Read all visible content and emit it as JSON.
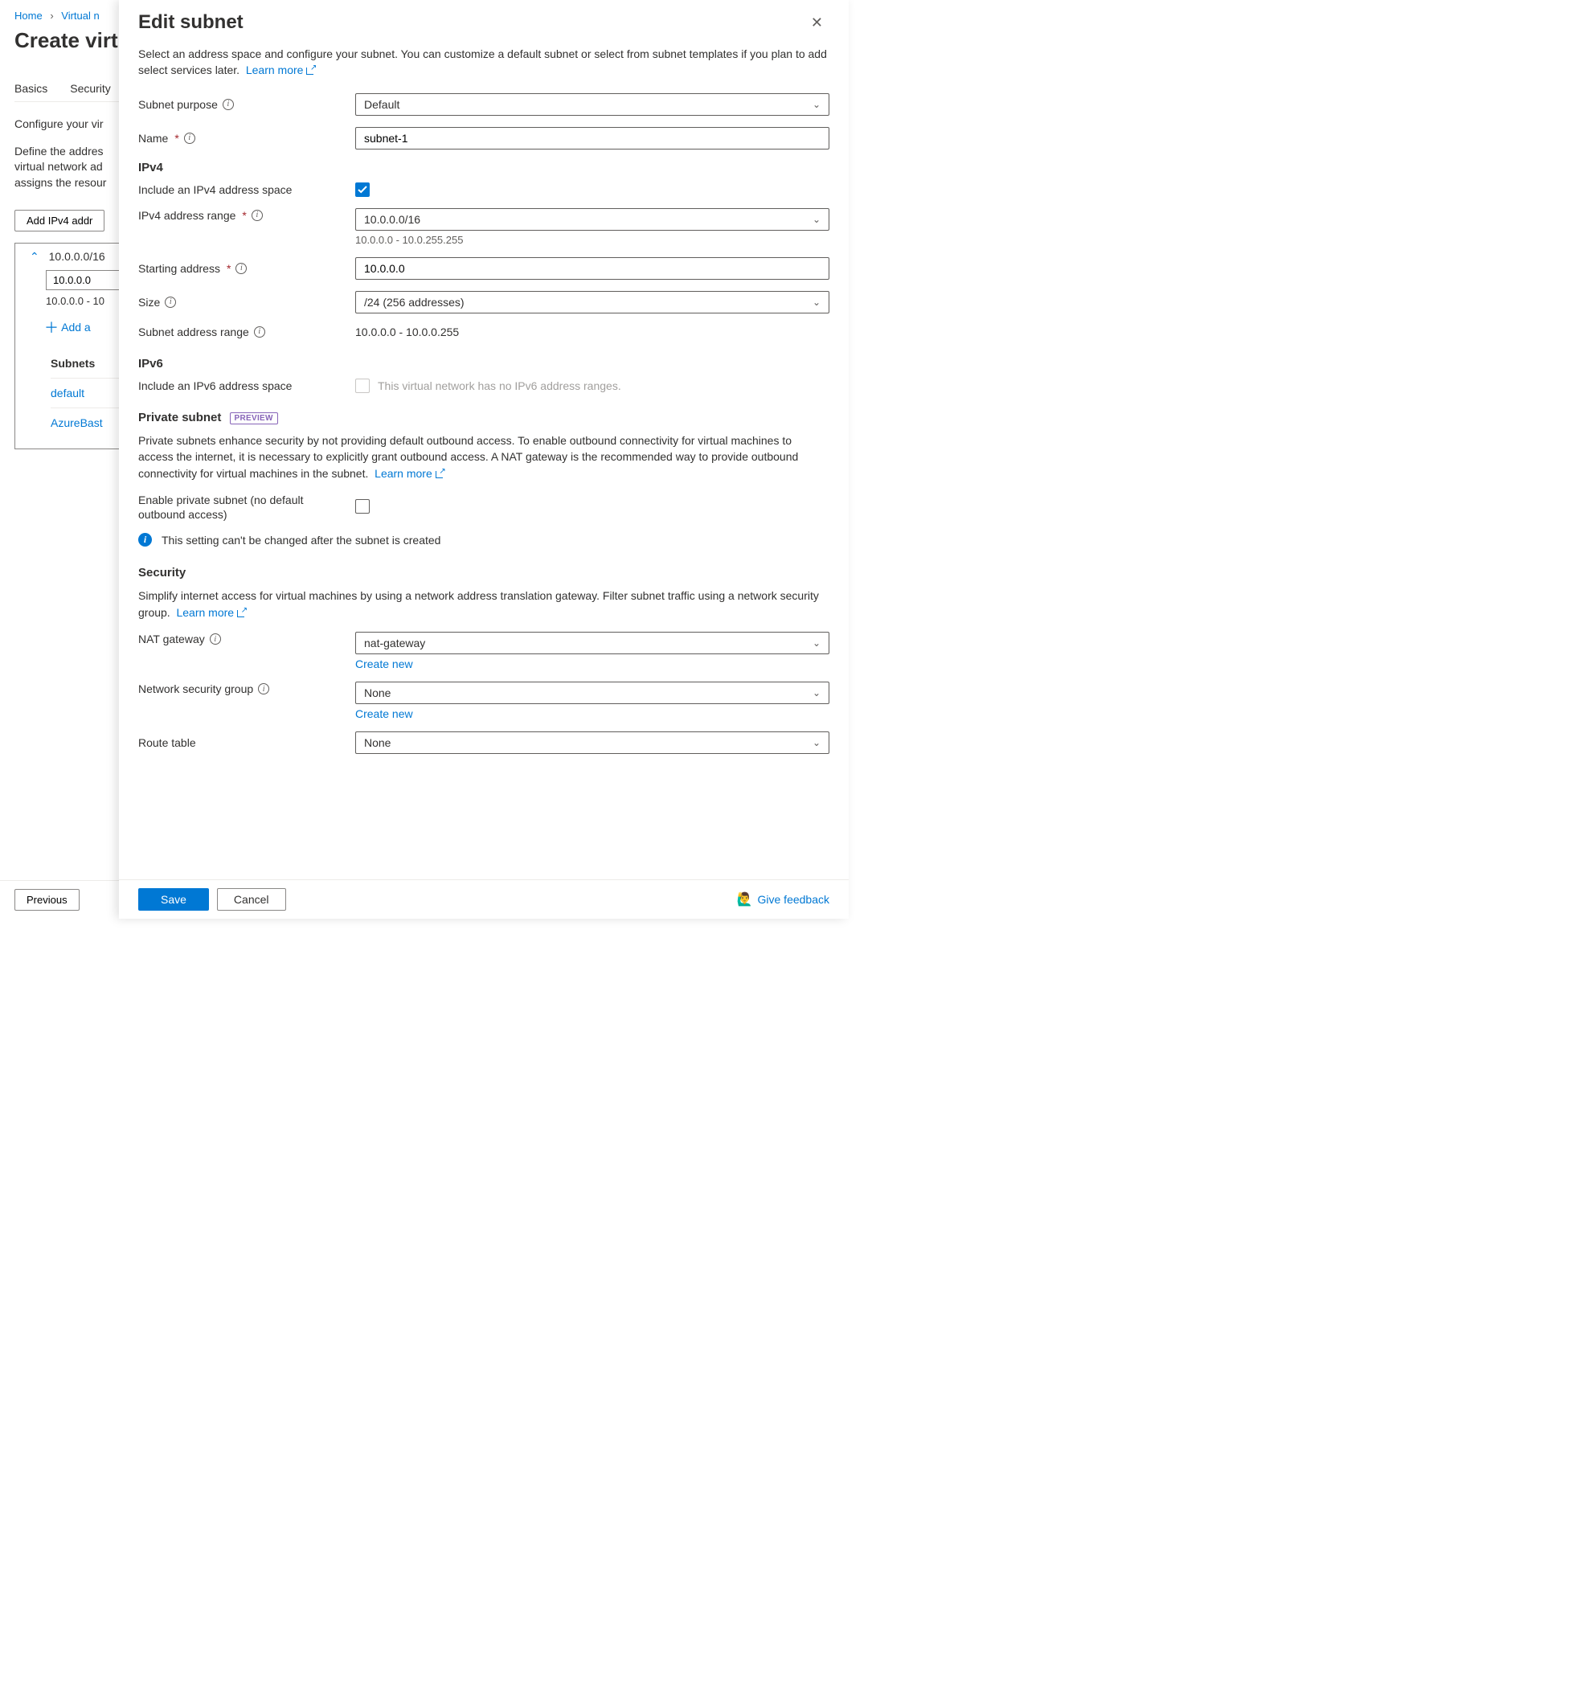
{
  "underlay": {
    "breadcrumb": {
      "home": "Home",
      "vn": "Virtual n"
    },
    "title": "Create virt",
    "tabs": {
      "basics": "Basics",
      "security": "Security"
    },
    "desc1": "Configure your vir",
    "desc2": "Define the addres",
    "desc3": "virtual network ad",
    "desc4": "assigns the resour",
    "add_button": "Add IPv4 addr",
    "cidr_line": "10.0.0.0/16",
    "addr_input": "10.0.0.0",
    "range_line": "10.0.0.0 - 10",
    "add_subnet": "Add a",
    "subnets_header": "Subnets",
    "subnet_default": "default",
    "subnet_bastion": "AzureBast",
    "previous": "Previous"
  },
  "panel": {
    "title": "Edit subnet",
    "intro": "Select an address space and configure your subnet. You can customize a default subnet or select from subnet templates if you plan to add select services later.",
    "learn_more": "Learn more",
    "purpose_label": "Subnet purpose",
    "purpose_value": "Default",
    "name_label": "Name",
    "name_value": "subnet-1",
    "ipv4_header": "IPv4",
    "include_ipv4_label": "Include an IPv4 address space",
    "ipv4_range_label": "IPv4 address range",
    "ipv4_range_value": "10.0.0.0/16",
    "ipv4_range_hint": "10.0.0.0 - 10.0.255.255",
    "starting_label": "Starting address",
    "starting_value": "10.0.0.0",
    "size_label": "Size",
    "size_value": "/24 (256 addresses)",
    "subnet_range_label": "Subnet address range",
    "subnet_range_value": "10.0.0.0 - 10.0.0.255",
    "ipv6_header": "IPv6",
    "include_ipv6_label": "Include an IPv6 address space",
    "ipv6_disabled_msg": "This virtual network has no IPv6 address ranges.",
    "private_header": "Private subnet",
    "preview_badge": "PREVIEW",
    "private_desc": "Private subnets enhance security by not providing default outbound access. To enable outbound connectivity for virtual machines to access the internet, it is necessary to explicitly grant outbound access. A NAT gateway is the recommended way to provide outbound connectivity for virtual machines in the subnet.",
    "enable_private_label": "Enable private subnet (no default outbound access)",
    "private_warning": "This setting can't be changed after the subnet is created",
    "security_header": "Security",
    "security_desc": "Simplify internet access for virtual machines by using a network address translation gateway. Filter subnet traffic using a network security group.",
    "nat_label": "NAT gateway",
    "nat_value": "nat-gateway",
    "nsg_label": "Network security group",
    "nsg_value": "None",
    "route_label": "Route table",
    "route_value": "None",
    "create_new": "Create new",
    "save": "Save",
    "cancel": "Cancel",
    "feedback": "Give feedback"
  }
}
